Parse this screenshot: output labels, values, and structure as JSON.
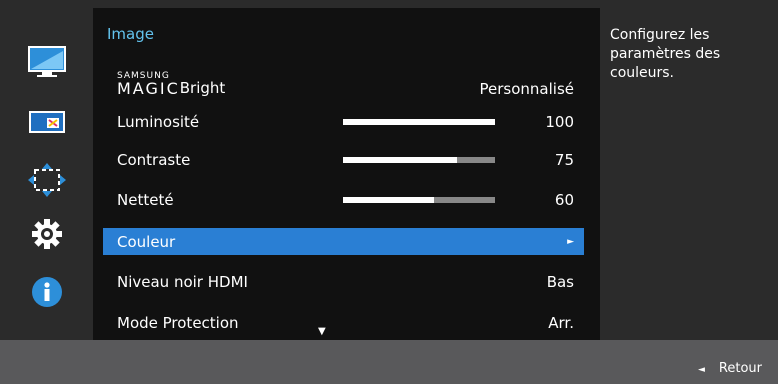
{
  "sidebar": {
    "icons": [
      "picture-icon",
      "pip-icon",
      "position-icon",
      "settings-gear-icon",
      "information-icon"
    ]
  },
  "menu": {
    "title": "Image",
    "magic_small": "SAMSUNG",
    "magic_big": "MAGIC",
    "items": [
      {
        "label": "Bright",
        "value": "Personnalisé"
      },
      {
        "label": "Luminosité",
        "value": "100",
        "level": 1.0
      },
      {
        "label": "Contraste",
        "value": "75",
        "level": 0.75
      },
      {
        "label": "Netteté",
        "value": "60",
        "level": 0.6
      },
      {
        "label": "Couleur",
        "value": "►"
      },
      {
        "label": "Niveau noir HDMI",
        "value": "Bas"
      },
      {
        "label": "Mode Protection",
        "value": "Arr."
      }
    ],
    "scroll_indicator": "▼"
  },
  "help": {
    "text": "Configurez les paramètres des couleurs."
  },
  "footer": {
    "back_arrow": "◄",
    "back_label": "Retour"
  },
  "colors": {
    "accent": "#2a7fd4",
    "title": "#63c3ee"
  }
}
